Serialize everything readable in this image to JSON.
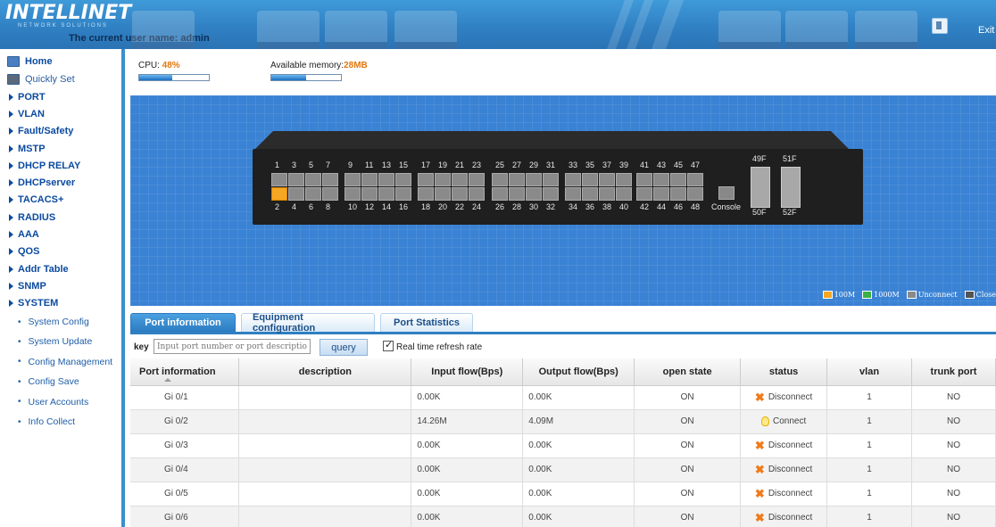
{
  "header": {
    "logo": "INTELLINET",
    "logo_sub": "NETWORK SOLUTIONS",
    "current_user_label": "The current user name: admin",
    "exit_label": "Exit"
  },
  "sidebar": {
    "home": "Home",
    "quickly_set": "Quickly Set",
    "menu": [
      "PORT",
      "VLAN",
      "Fault/Safety",
      "MSTP",
      "DHCP RELAY",
      "DHCPserver",
      "TACACS+",
      "RADIUS",
      "AAA",
      "QOS",
      "Addr Table",
      "SNMP"
    ],
    "system_label": "SYSTEM",
    "system_items": [
      "System Config",
      "System Update",
      "Config Management",
      "Config Save",
      "User Accounts",
      "Info Collect"
    ]
  },
  "stats": {
    "cpu_label": "CPU: ",
    "cpu_value": "48%",
    "cpu_fraction": 0.48,
    "memory_label": "Available memory:",
    "memory_value": "28MB",
    "memory_fraction": 0.5
  },
  "switch": {
    "top_row_labels": [
      "1",
      "3",
      "5",
      "7",
      "9",
      "11",
      "13",
      "15",
      "17",
      "19",
      "21",
      "23",
      "25",
      "27",
      "29",
      "31",
      "33",
      "35",
      "37",
      "39",
      "41",
      "43",
      "45",
      "47"
    ],
    "bottom_row_labels": [
      "2",
      "4",
      "6",
      "8",
      "10",
      "12",
      "14",
      "16",
      "18",
      "20",
      "22",
      "24",
      "26",
      "28",
      "30",
      "32",
      "34",
      "36",
      "38",
      "40",
      "42",
      "44",
      "46",
      "48"
    ],
    "console_label": "Console",
    "sfp_top": [
      "49F",
      "51F"
    ],
    "sfp_bottom": [
      "50F",
      "52F"
    ],
    "active_port": "2"
  },
  "legend": [
    {
      "label": "100M",
      "color": "#f5a623"
    },
    {
      "label": "1000M",
      "color": "#3cb043"
    },
    {
      "label": "Unconnect",
      "color": "#8a8a8a"
    },
    {
      "label": "Close",
      "color": "#555555"
    }
  ],
  "tabs": [
    "Port information",
    "Equipment configuration",
    "Port Statistics"
  ],
  "query": {
    "key_label": "key",
    "placeholder": "Input port number or port description",
    "query_button": "query",
    "refresh_label": "Real time refresh rate"
  },
  "table": {
    "headers": [
      "Port information",
      "description",
      "Input flow(Bps)",
      "Output flow(Bps)",
      "open state",
      "status",
      "vlan",
      "trunk port"
    ],
    "rows": [
      {
        "port": "Gi 0/1",
        "description": "",
        "input": "0.00K",
        "output": "0.00K",
        "open": "ON",
        "status": "Disconnect",
        "status_icon": "disconnect-icon",
        "vlan": "1",
        "trunk": "NO"
      },
      {
        "port": "Gi 0/2",
        "description": "",
        "input": "14.26M",
        "output": "4.09M",
        "open": "ON",
        "status": "Connect",
        "status_icon": "bulb-icon",
        "vlan": "1",
        "trunk": "NO"
      },
      {
        "port": "Gi 0/3",
        "description": "",
        "input": "0.00K",
        "output": "0.00K",
        "open": "ON",
        "status": "Disconnect",
        "status_icon": "disconnect-icon",
        "vlan": "1",
        "trunk": "NO"
      },
      {
        "port": "Gi 0/4",
        "description": "",
        "input": "0.00K",
        "output": "0.00K",
        "open": "ON",
        "status": "Disconnect",
        "status_icon": "disconnect-icon",
        "vlan": "1",
        "trunk": "NO"
      },
      {
        "port": "Gi 0/5",
        "description": "",
        "input": "0.00K",
        "output": "0.00K",
        "open": "ON",
        "status": "Disconnect",
        "status_icon": "disconnect-icon",
        "vlan": "1",
        "trunk": "NO"
      },
      {
        "port": "Gi 0/6",
        "description": "",
        "input": "0.00K",
        "output": "0.00K",
        "open": "ON",
        "status": "Disconnect",
        "status_icon": "disconnect-icon",
        "vlan": "1",
        "trunk": "NO"
      }
    ]
  }
}
